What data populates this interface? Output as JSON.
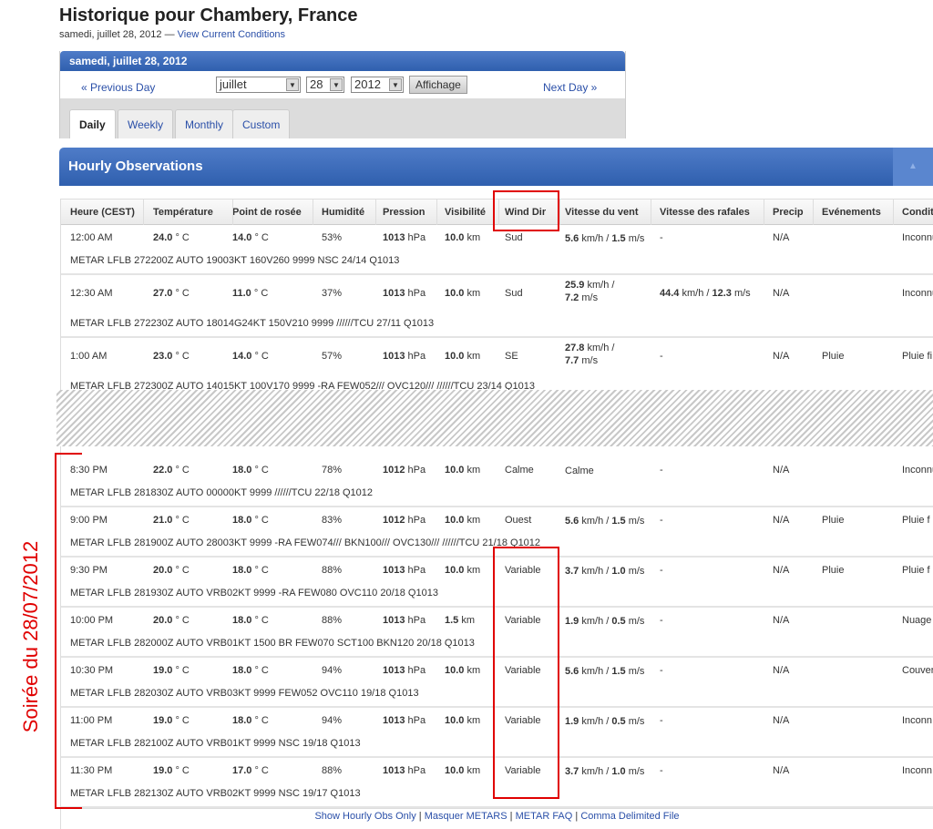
{
  "page": {
    "title": "Historique pour Chambery, France",
    "date": "samedi, juillet 28, 2012",
    "dash": "—",
    "current_link": "View Current Conditions"
  },
  "datebox": {
    "header": "samedi, juillet 28, 2012",
    "prev": "« Previous Day",
    "next": "Next Day »",
    "month": "juillet",
    "day": "28",
    "year": "2012",
    "submit": "Affichage",
    "tabs": [
      "Daily",
      "Weekly",
      "Monthly",
      "Custom"
    ],
    "active_tab": "Daily"
  },
  "obs": {
    "title": "Hourly Observations",
    "toggle_icon": "▲",
    "columns": [
      "Heure (CEST)",
      "Température",
      "Point de rosée",
      "Humidité",
      "Pression",
      "Visibilité",
      "Wind Dir",
      "Vitesse du vent",
      "Vitesse des rafales",
      "Precip",
      "Evénements",
      "Conditions"
    ],
    "rows": [
      {
        "time": "12:00 AM",
        "temp": "24.0",
        "dew": "14.0",
        "hum": "53%",
        "press": "1013",
        "vis": "10.0",
        "dir": "Sud",
        "wind": "5.6",
        "wind_ms": "1.5",
        "gust": "-",
        "gust_ms": "",
        "precip": "N/A",
        "events": "",
        "cond": "Inconnu",
        "metar": "METAR LFLB 272200Z AUTO 19003KT 160V260 9999 NSC 24/14 Q1013"
      },
      {
        "time": "12:30 AM",
        "temp": "27.0",
        "dew": "11.0",
        "hum": "37%",
        "press": "1013",
        "vis": "10.0",
        "dir": "Sud",
        "wind": "25.9",
        "wind_ms": "7.2",
        "gust": "44.4",
        "gust_ms": "12.3",
        "precip": "N/A",
        "events": "",
        "cond": "Inconnu",
        "metar": "METAR LFLB 272230Z AUTO 18014G24KT 150V210 9999 //////TCU 27/11 Q1013"
      },
      {
        "time": "1:00 AM",
        "temp": "23.0",
        "dew": "14.0",
        "hum": "57%",
        "press": "1013",
        "vis": "10.0",
        "dir": "SE",
        "wind": "27.8",
        "wind_ms": "7.7",
        "gust": "-",
        "gust_ms": "",
        "precip": "N/A",
        "events": "Pluie",
        "cond": "Pluie fi",
        "metar": "METAR LFLB 272300Z AUTO 14015KT 100V170 9999 -RA FEW052/// OVC120/// //////TCU 23/14 Q1013"
      },
      {
        "time": "8:30 PM",
        "temp": "22.0",
        "dew": "18.0",
        "hum": "78%",
        "press": "1012",
        "vis": "10.0",
        "dir": "Calme",
        "wind": "Calme",
        "wind_ms": "",
        "gust": "-",
        "gust_ms": "",
        "precip": "N/A",
        "events": "",
        "cond": "Inconnu",
        "metar": "METAR LFLB 281830Z AUTO 00000KT 9999 //////TCU 22/18 Q1012"
      },
      {
        "time": "9:00 PM",
        "temp": "21.0",
        "dew": "18.0",
        "hum": "83%",
        "press": "1012",
        "vis": "10.0",
        "dir": "Ouest",
        "wind": "5.6",
        "wind_ms": "1.5",
        "gust": "-",
        "gust_ms": "",
        "precip": "N/A",
        "events": "Pluie",
        "cond": "Pluie f",
        "metar": "METAR LFLB 281900Z AUTO 28003KT 9999 -RA FEW074/// BKN100/// OVC130/// //////TCU 21/18 Q1012"
      },
      {
        "time": "9:30 PM",
        "temp": "20.0",
        "dew": "18.0",
        "hum": "88%",
        "press": "1013",
        "vis": "10.0",
        "dir": "Variable",
        "wind": "3.7",
        "wind_ms": "1.0",
        "gust": "-",
        "gust_ms": "",
        "precip": "N/A",
        "events": "Pluie",
        "cond": "Pluie f",
        "metar": "METAR LFLB 281930Z AUTO VRB02KT 9999 -RA FEW080 OVC110 20/18 Q1013"
      },
      {
        "time": "10:00 PM",
        "temp": "20.0",
        "dew": "18.0",
        "hum": "88%",
        "press": "1013",
        "vis": "1.5",
        "dir": "Variable",
        "wind": "1.9",
        "wind_ms": "0.5",
        "gust": "-",
        "gust_ms": "",
        "precip": "N/A",
        "events": "",
        "cond": "Nuage",
        "metar": "METAR LFLB 282000Z AUTO VRB01KT 1500 BR FEW070 SCT100 BKN120 20/18 Q1013"
      },
      {
        "time": "10:30 PM",
        "temp": "19.0",
        "dew": "18.0",
        "hum": "94%",
        "press": "1013",
        "vis": "10.0",
        "dir": "Variable",
        "wind": "5.6",
        "wind_ms": "1.5",
        "gust": "-",
        "gust_ms": "",
        "precip": "N/A",
        "events": "",
        "cond": "Couver",
        "metar": "METAR LFLB 282030Z AUTO VRB03KT 9999 FEW052 OVC110 19/18 Q1013"
      },
      {
        "time": "11:00 PM",
        "temp": "19.0",
        "dew": "18.0",
        "hum": "94%",
        "press": "1013",
        "vis": "10.0",
        "dir": "Variable",
        "wind": "1.9",
        "wind_ms": "0.5",
        "gust": "-",
        "gust_ms": "",
        "precip": "N/A",
        "events": "",
        "cond": "Inconn",
        "metar": "METAR LFLB 282100Z AUTO VRB01KT 9999 NSC 19/18 Q1013"
      },
      {
        "time": "11:30 PM",
        "temp": "19.0",
        "dew": "17.0",
        "hum": "88%",
        "press": "1013",
        "vis": "10.0",
        "dir": "Variable",
        "wind": "3.7",
        "wind_ms": "1.0",
        "gust": "-",
        "gust_ms": "",
        "precip": "N/A",
        "events": "",
        "cond": "Inconn",
        "metar": "METAR LFLB 282130Z AUTO VRB02KT 9999 NSC 19/17 Q1013"
      }
    ]
  },
  "units": {
    "temp": " ° C",
    "press": " hPa",
    "vis": " km",
    "kmh": " km/h",
    "ms": " m/s",
    "slash": " / "
  },
  "footer": {
    "links": [
      "Show Hourly Obs Only",
      "Masquer METARS",
      "METAR FAQ",
      "Comma Delimited File"
    ],
    "sep": " | "
  },
  "annotation": {
    "text": "Soirée du 28/07/2012",
    "color": "#e00000"
  }
}
